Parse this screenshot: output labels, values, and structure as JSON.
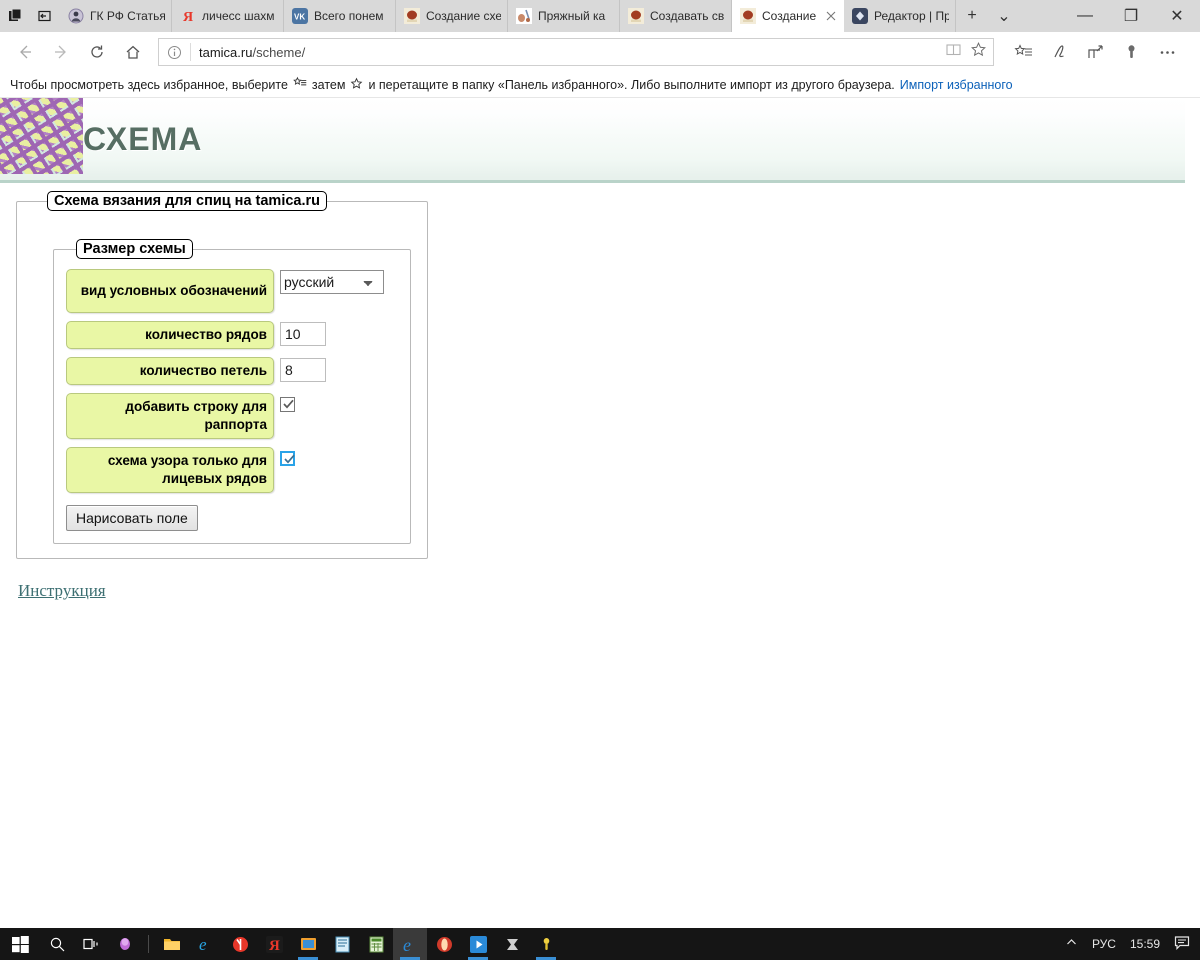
{
  "browser": {
    "tabs": [
      {
        "title": "ГК РФ Статья",
        "favicon": "avatar-icon",
        "active": false
      },
      {
        "title": "личесс шахм",
        "favicon": "yandex-icon",
        "active": false
      },
      {
        "title": "Всего понем",
        "favicon": "vk-icon",
        "active": false
      },
      {
        "title": "Создание схе",
        "favicon": "yarn-icon",
        "active": false
      },
      {
        "title": "Пряжный ка",
        "favicon": "knit-icon",
        "active": false
      },
      {
        "title": "Создавать св",
        "favicon": "yarn-icon",
        "active": false
      },
      {
        "title": "Создание",
        "favicon": "yarn-icon",
        "active": true
      },
      {
        "title": "Редактор | Пр",
        "favicon": "editor-icon",
        "active": false
      }
    ],
    "new_tab_label": "+",
    "tab_menu_label": "⌄",
    "window_controls": {
      "minimize": "—",
      "maximize": "❐",
      "close": "✕"
    },
    "nav": {
      "back": "back-arrow-icon",
      "forward": "forward-arrow-icon",
      "refresh": "refresh-icon",
      "home": "home-icon"
    },
    "address": {
      "info_icon": "info-icon",
      "host": "tamica.ru",
      "path": "/scheme/",
      "reading_view": "reading-view-icon",
      "favorite": "star-icon"
    },
    "toolbar_actions": [
      "reading-list-icon",
      "notes-pen-icon",
      "share-icon",
      "flashlight-icon",
      "more-icon"
    ],
    "favorites_bar": {
      "text_before": "Чтобы просмотреть здесь избранное, выберите",
      "glyph1": "reading-list-icon",
      "text_mid": "затем",
      "glyph2": "star-icon",
      "text_after": "и перетащите в папку «Панель избранного». Либо выполните импорт из другого браузера.",
      "import_link": "Импорт избранного"
    }
  },
  "page": {
    "site_title": "СХЕМА",
    "logo": "knitting-pattern-logo",
    "outer_legend": "Схема вязания для спиц на tamica.ru",
    "inner_legend": "Размер схемы",
    "fields": [
      {
        "label": "вид условных обозначений",
        "type": "select",
        "value": "русский",
        "options": [
          "русский"
        ]
      },
      {
        "label": "количество рядов",
        "type": "number",
        "value": "10"
      },
      {
        "label": "количество петель",
        "type": "number",
        "value": "8"
      },
      {
        "label": "добавить строку для раппорта",
        "type": "checkbox",
        "checked": true,
        "focused": false
      },
      {
        "label": "схема узора только для лицевых рядов",
        "type": "checkbox",
        "checked": true,
        "focused": true
      }
    ],
    "draw_button": "Нарисовать поле",
    "instruction_link": "Инструкция",
    "colors": {
      "label_bg": "#e9f7a5",
      "title_text": "#566e63",
      "header_border": "#b9d3c9",
      "link": "#3d6f72",
      "focus_blue": "#2aa3e8"
    }
  },
  "taskbar": {
    "start": "windows-start-icon",
    "search": "search-icon",
    "task_view": "task-view-icon",
    "items": [
      "cortana-icon",
      "file-explorer-icon",
      "internet-explorer-icon",
      "yandex-browser-icon",
      "yandex-icon",
      "photo-viewer-icon",
      "notepad-icon",
      "calc-icon",
      "edge-icon",
      "opera-icon",
      "media-player-icon",
      "scanner-icon",
      "flashlight-icon"
    ],
    "tray": {
      "chevron": "show-hidden-icons-icon",
      "language": "РУС",
      "clock": "15:59",
      "action_center": "action-center-icon"
    }
  }
}
